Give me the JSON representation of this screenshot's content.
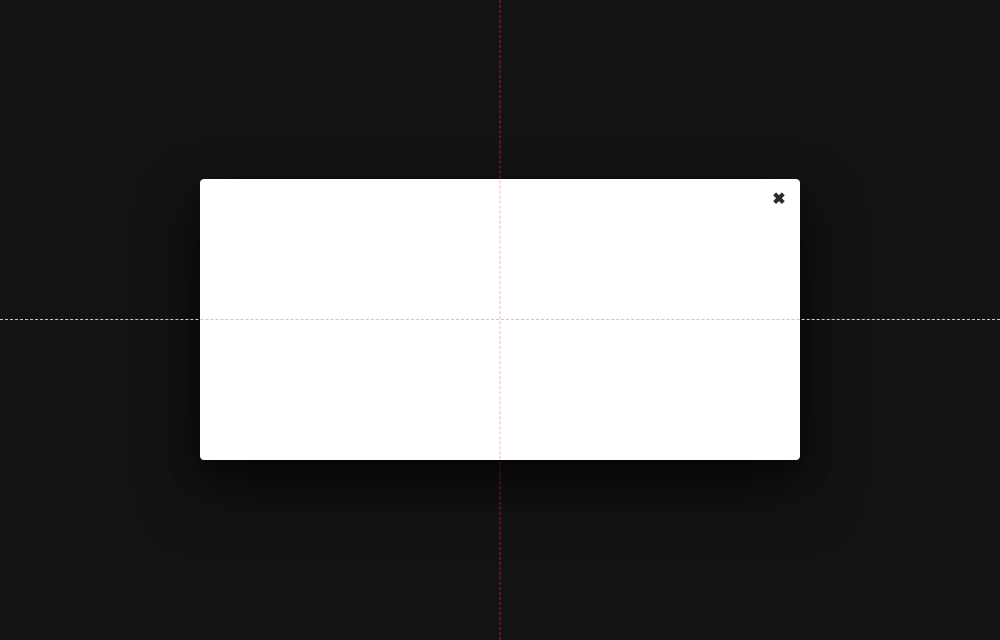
{
  "guides": {
    "color_behind": "#a8127d",
    "color_front": "#f9a9e6"
  },
  "modal": {
    "close_glyph": "✖"
  }
}
